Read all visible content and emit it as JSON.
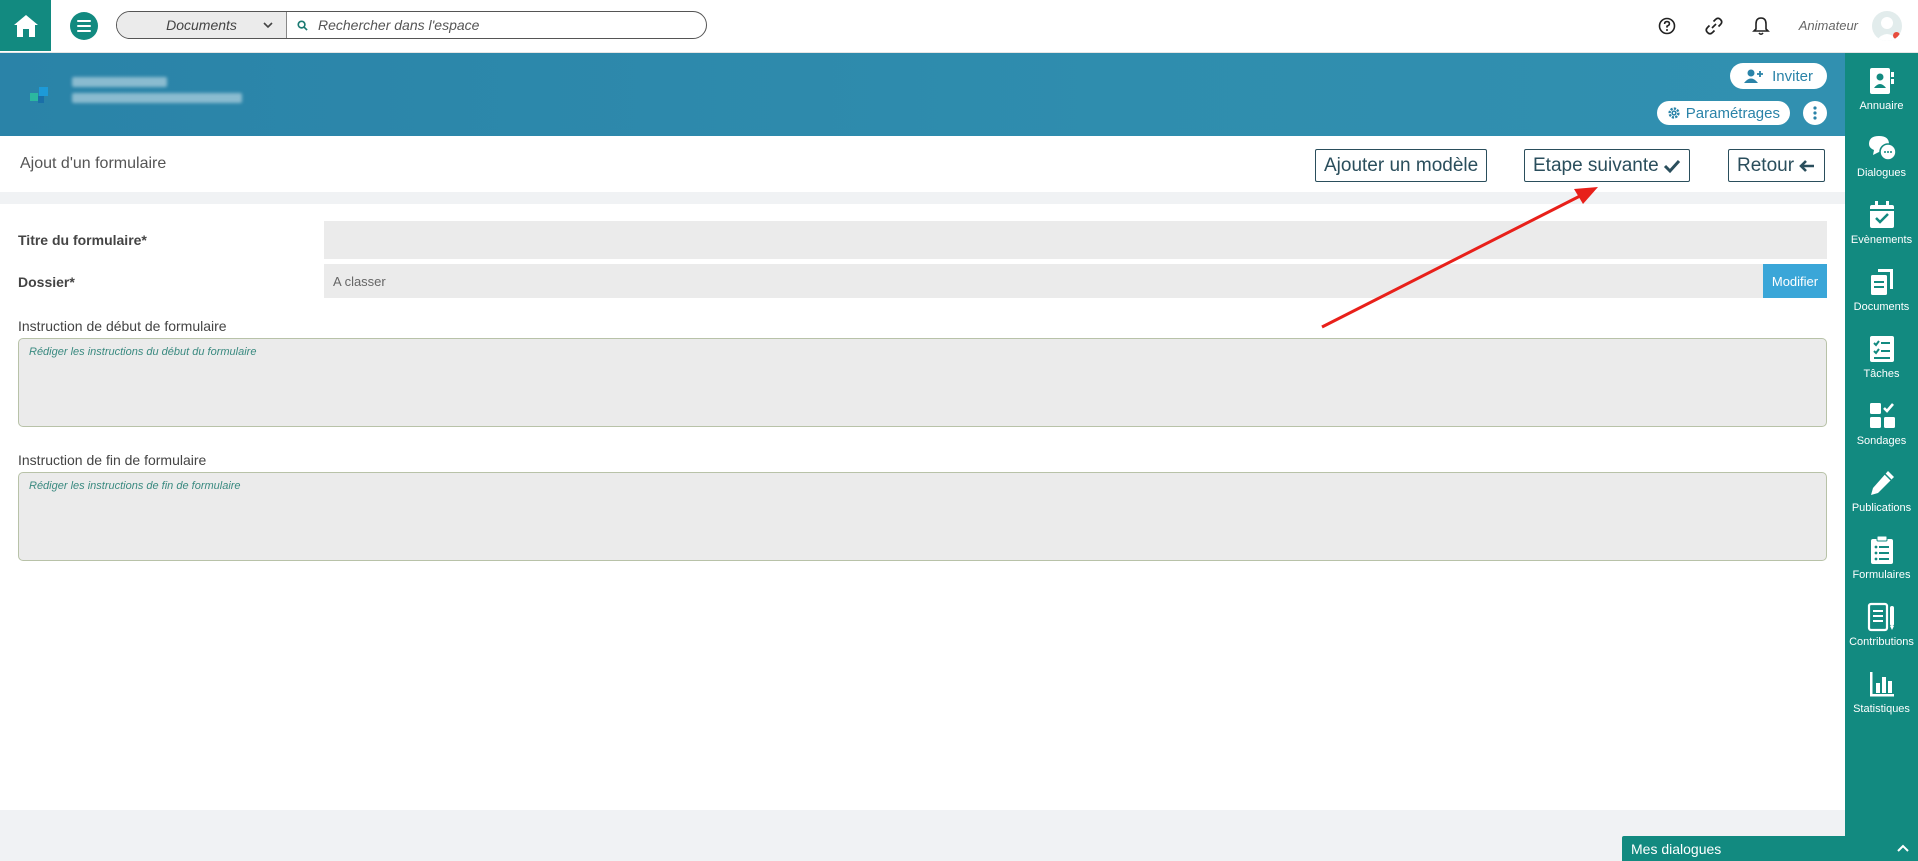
{
  "topbar": {
    "scope_select": "Documents",
    "search_placeholder": "Rechercher dans l'espace",
    "user_name": "Animateur"
  },
  "banner": {
    "invite_label": "Inviter",
    "settings_label": "Paramétrages"
  },
  "page": {
    "title": "Ajout d'un formulaire",
    "add_model_label": "Ajouter un modèle",
    "next_step_label": "Etape suivante",
    "back_label": "Retour"
  },
  "form": {
    "title_label": "Titre du formulaire*",
    "title_value": "",
    "folder_label": "Dossier*",
    "folder_value": "A classer",
    "modify_label": "Modifier",
    "start_instruction_label": "Instruction de début de formulaire",
    "start_instruction_placeholder": "Rédiger les instructions du début du formulaire",
    "end_instruction_label": "Instruction de fin de formulaire",
    "end_instruction_placeholder": "Rédiger les instructions de fin de formulaire"
  },
  "sidebar": {
    "items": [
      {
        "label": "Annuaire",
        "icon": "address-book-icon"
      },
      {
        "label": "Dialogues",
        "icon": "chat-bubbles-icon"
      },
      {
        "label": "Evènements",
        "icon": "calendar-check-icon"
      },
      {
        "label": "Documents",
        "icon": "documents-icon"
      },
      {
        "label": "Tâches",
        "icon": "task-list-icon"
      },
      {
        "label": "Sondages",
        "icon": "poll-icon"
      },
      {
        "label": "Publications",
        "icon": "pencil-icon"
      },
      {
        "label": "Formulaires",
        "icon": "form-list-icon"
      },
      {
        "label": "Contributions",
        "icon": "contributions-icon"
      },
      {
        "label": "Statistiques",
        "icon": "bar-chart-icon"
      }
    ]
  },
  "chat": {
    "label": "Mes dialogues"
  },
  "colors": {
    "primary": "#128a80",
    "banner": "#2a83a8",
    "modify_button": "#3aa6d8",
    "annotation_arrow": "#e8201a"
  }
}
